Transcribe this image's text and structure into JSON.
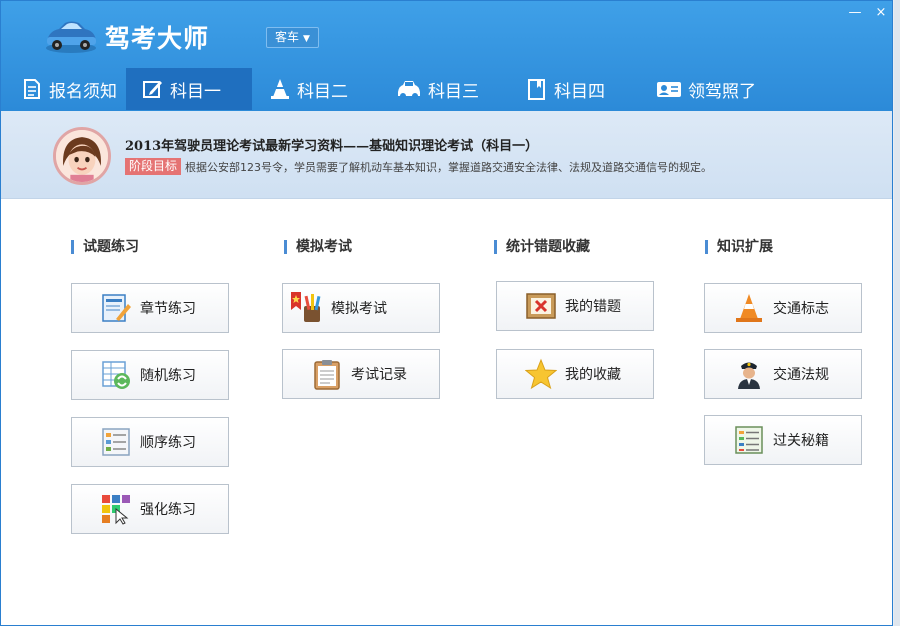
{
  "app": {
    "title": "驾考大师",
    "vehicle_select": "客车",
    "minimize_glyph": "—",
    "close_glyph": "×"
  },
  "nav": {
    "items": [
      {
        "label": "报名须知",
        "icon": "document-icon"
      },
      {
        "label": "科目一",
        "icon": "edit-icon"
      },
      {
        "label": "科目二",
        "icon": "traffic-cone-icon"
      },
      {
        "label": "科目三",
        "icon": "car-icon"
      },
      {
        "label": "科目四",
        "icon": "book-icon"
      },
      {
        "label": "领驾照了",
        "icon": "id-card-icon"
      }
    ],
    "active_index": 1
  },
  "banner": {
    "title": "2013年驾驶员理论考试最新学习资料——基础知识理论考试（科目一）",
    "badge": "阶段目标",
    "description": "根据公安部123号令，学员需要了解机动车基本知识，掌握道路交通安全法律、法规及道路交通信号的规定。"
  },
  "sections": [
    {
      "title": "试题练习",
      "buttons": [
        {
          "label": "章节练习",
          "icon": "chapter-practice-icon"
        },
        {
          "label": "随机练习",
          "icon": "random-practice-icon"
        },
        {
          "label": "顺序练习",
          "icon": "sequential-practice-icon"
        },
        {
          "label": "强化练习",
          "icon": "intensive-practice-icon"
        }
      ]
    },
    {
      "title": "模拟考试",
      "buttons": [
        {
          "label": "模拟考试",
          "icon": "mock-exam-icon"
        },
        {
          "label": "考试记录",
          "icon": "clipboard-icon"
        }
      ]
    },
    {
      "title": "统计错题收藏",
      "buttons": [
        {
          "label": "我的错题",
          "icon": "wrong-answer-icon"
        },
        {
          "label": "我的收藏",
          "icon": "star-icon"
        }
      ]
    },
    {
      "title": "知识扩展",
      "buttons": [
        {
          "label": "交通标志",
          "icon": "traffic-cone-icon"
        },
        {
          "label": "交通法规",
          "icon": "police-officer-icon"
        },
        {
          "label": "过关秘籍",
          "icon": "cheat-sheet-icon"
        }
      ]
    }
  ],
  "colors": {
    "titlebar": "#2c8ad8",
    "active_tab": "#1f6fbf",
    "badge": "#e57373"
  }
}
